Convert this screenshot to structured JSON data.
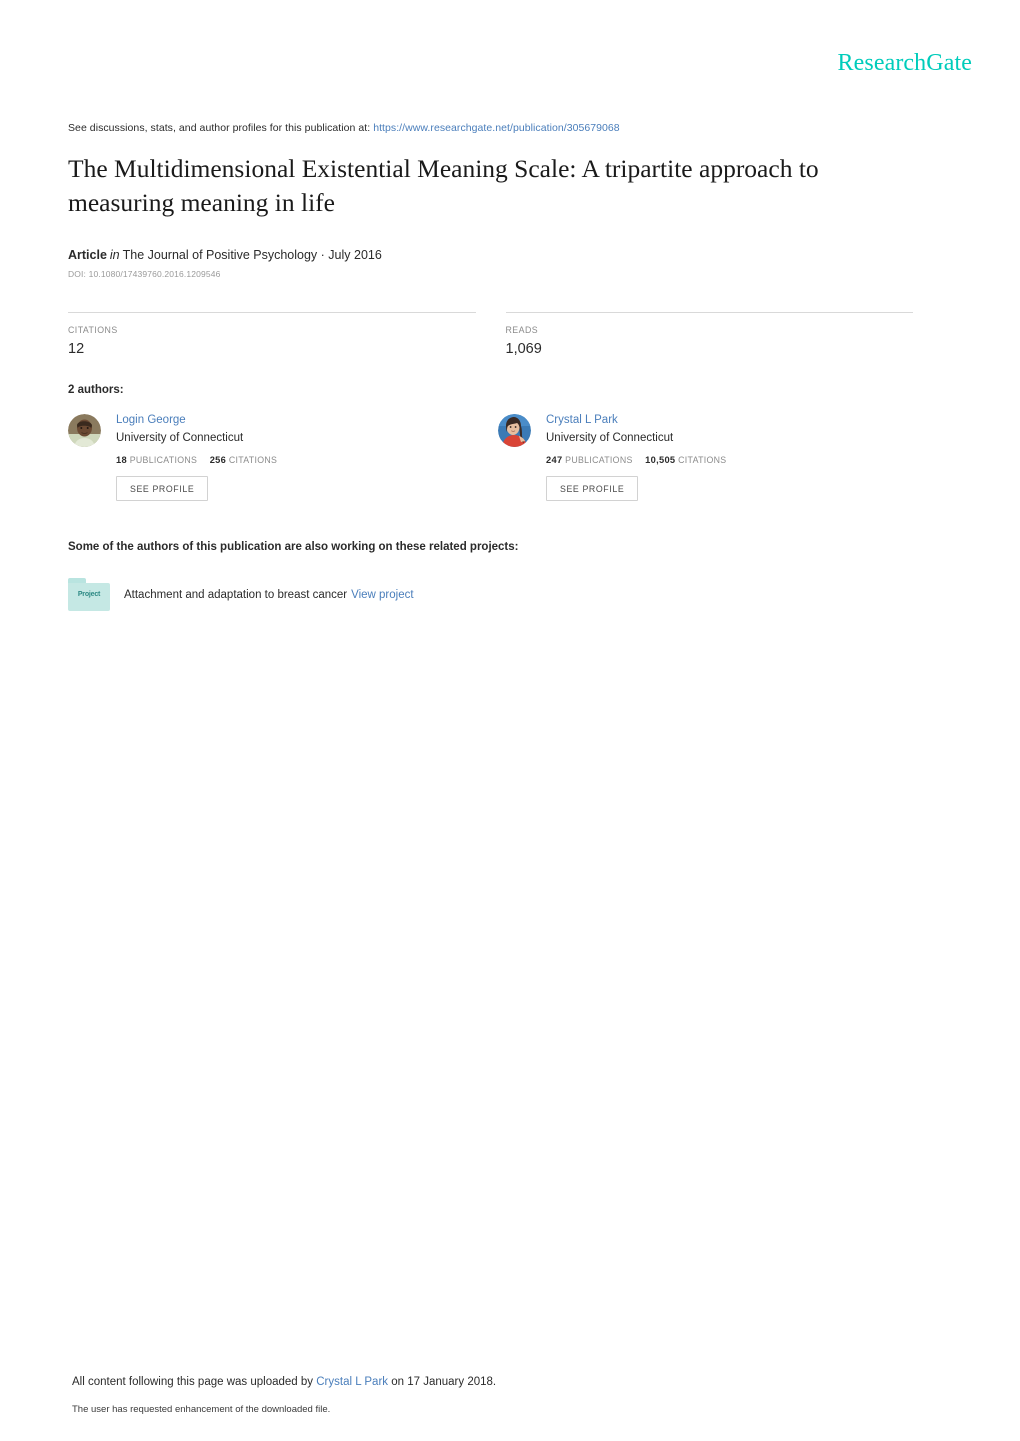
{
  "brand": {
    "logo_text": "ResearchGate",
    "accent_color": "#00ccbb",
    "link_color": "#4a7ebb"
  },
  "header": {
    "discussion_prefix": "See discussions, stats, and author profiles for this publication at:",
    "discussion_url": "https://www.researchgate.net/publication/305679068"
  },
  "publication": {
    "title": "The Multidimensional Existential Meaning Scale: A tripartite approach to measuring meaning in life",
    "type_label": "Article",
    "in_label": "in",
    "venue": "The Journal of Positive Psychology · July 2016",
    "doi": "DOI: 10.1080/17439760.2016.1209546"
  },
  "stats": [
    {
      "label": "CITATIONS",
      "value": "12"
    },
    {
      "label": "READS",
      "value": "1,069"
    }
  ],
  "authors_section": {
    "heading": "2 authors:",
    "authors": [
      {
        "name": "Login George",
        "affiliation": "University of Connecticut",
        "publications_count": "18",
        "publications_label": "PUBLICATIONS",
        "citations_count": "256",
        "citations_label": "CITATIONS",
        "profile_button": "SEE PROFILE"
      },
      {
        "name": "Crystal L Park",
        "affiliation": "University of Connecticut",
        "publications_count": "247",
        "publications_label": "PUBLICATIONS",
        "citations_count": "10,505",
        "citations_label": "CITATIONS",
        "profile_button": "SEE PROFILE"
      }
    ]
  },
  "projects_section": {
    "heading": "Some of the authors of this publication are also working on these related projects:",
    "projects": [
      {
        "icon_label": "Project",
        "title": "Attachment and adaptation to breast cancer",
        "view_link": "View project"
      }
    ]
  },
  "footer": {
    "upload_prefix": "All content following this page was uploaded by",
    "upload_author": "Crystal L Park",
    "upload_suffix": "on 17 January 2018.",
    "note": "The user has requested enhancement of the downloaded file."
  }
}
